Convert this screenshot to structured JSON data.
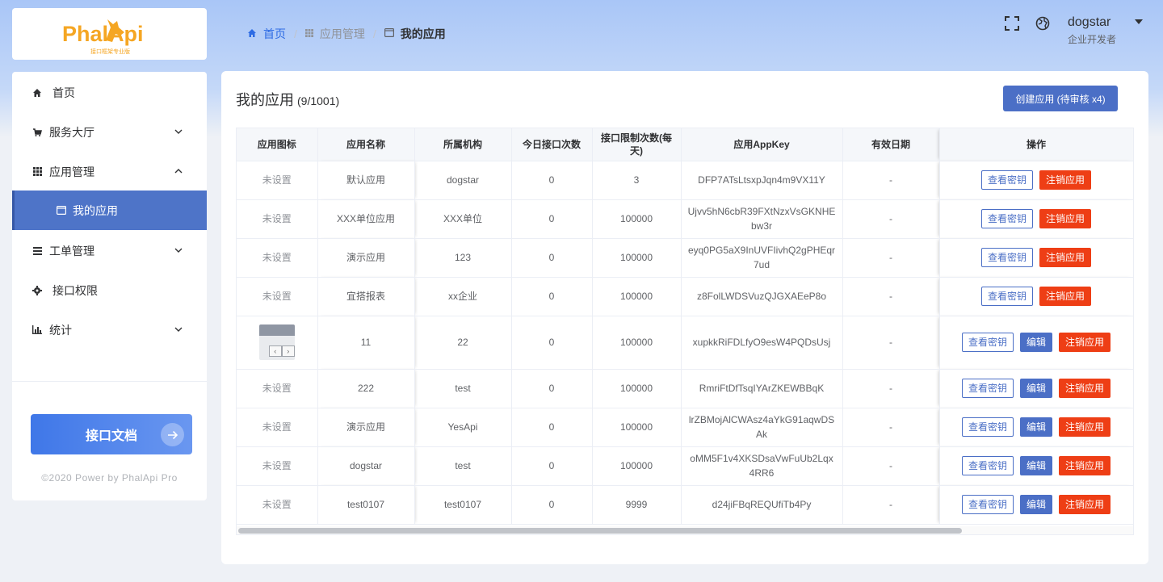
{
  "logo": {
    "text": "PhalApi",
    "subtitle": "接口框架专业版"
  },
  "sidebar": {
    "items": [
      {
        "label": "首页",
        "icon": "home-icon",
        "arrow": ""
      },
      {
        "label": "服务大厅",
        "icon": "cart-icon",
        "arrow": "⌄"
      },
      {
        "label": "应用管理",
        "icon": "grid-icon",
        "arrow": "⌃"
      },
      {
        "label": "我的应用",
        "icon": "window-icon",
        "arrow": ""
      },
      {
        "label": "工单管理",
        "icon": "list-icon",
        "arrow": "⌄"
      },
      {
        "label": "接口权限",
        "icon": "gear-icon",
        "arrow": ""
      },
      {
        "label": "统计",
        "icon": "bar-chart-icon",
        "arrow": "⌄"
      }
    ],
    "doc_button": "接口文档",
    "copyright": "©2020 Power by PhalApi Pro"
  },
  "breadcrumb": {
    "home": "首页",
    "mid": "应用管理",
    "current": "我的应用",
    "sep": "/"
  },
  "header": {
    "user_name": "dogstar",
    "user_role": "企业开发者"
  },
  "main": {
    "title": "我的应用",
    "count": "(9/1001)",
    "create_button": "创建应用 (待审核 x4)"
  },
  "table": {
    "headers": [
      "应用图标",
      "应用名称",
      "所属机构",
      "今日接口次数",
      "接口限制次数(每天)",
      "应用AppKey",
      "有效日期",
      "操作"
    ],
    "actions": {
      "view": "查看密钥",
      "edit": "编辑",
      "cancel": "注销应用"
    },
    "rows": [
      {
        "icon": "未设置",
        "name": "默认应用",
        "org": "dogstar",
        "today": "0",
        "limit": "3",
        "appkey": "DFP7ATsLtsxpJqn4m9VX11Y",
        "expire": "-"
      },
      {
        "icon": "未设置",
        "name": "XXX单位应用",
        "org": "XXX单位",
        "today": "0",
        "limit": "100000",
        "appkey": "Ujvv5hN6cbR39FXtNzxVsGKNHEbw3r",
        "expire": "-"
      },
      {
        "icon": "未设置",
        "name": "演示应用",
        "org": "123",
        "today": "0",
        "limit": "100000",
        "appkey": "eyq0PG5aX9InUVFIivhQ2gPHEqr7ud",
        "expire": "-"
      },
      {
        "icon": "未设置",
        "name": "宜搭报表",
        "org": "xx企业",
        "today": "0",
        "limit": "100000",
        "appkey": "z8FolLWDSVuzQJGXAEeP8o",
        "expire": "-"
      },
      {
        "icon": "",
        "name": "11",
        "org": "22",
        "today": "0",
        "limit": "100000",
        "appkey": "xupkkRiFDLfyO9esW4PQDsUsj",
        "expire": "-"
      },
      {
        "icon": "未设置",
        "name": "222",
        "org": "test",
        "today": "0",
        "limit": "100000",
        "appkey": "RmriFtDfTsqIYArZKEWBBqK",
        "expire": "-"
      },
      {
        "icon": "未设置",
        "name": "演示应用",
        "org": "YesApi",
        "today": "0",
        "limit": "100000",
        "appkey": "lrZBMojAlCWAsz4aYkG91aqwDSAk",
        "expire": "-"
      },
      {
        "icon": "未设置",
        "name": "dogstar",
        "org": "test",
        "today": "0",
        "limit": "100000",
        "appkey": "oMM5F1v4XKSDsaVwFuUb2Lqx4RR6",
        "expire": "-"
      },
      {
        "icon": "未设置",
        "name": "test0107",
        "org": "test0107",
        "today": "0",
        "limit": "9999",
        "appkey": "d24jiFBqREQUfiTb4Py",
        "expire": "-"
      }
    ]
  },
  "colors": {
    "accent": "#4b6fc6",
    "danger": "#ee3e15",
    "logo": "#f5a623",
    "active_menu": "#4e74c8"
  }
}
